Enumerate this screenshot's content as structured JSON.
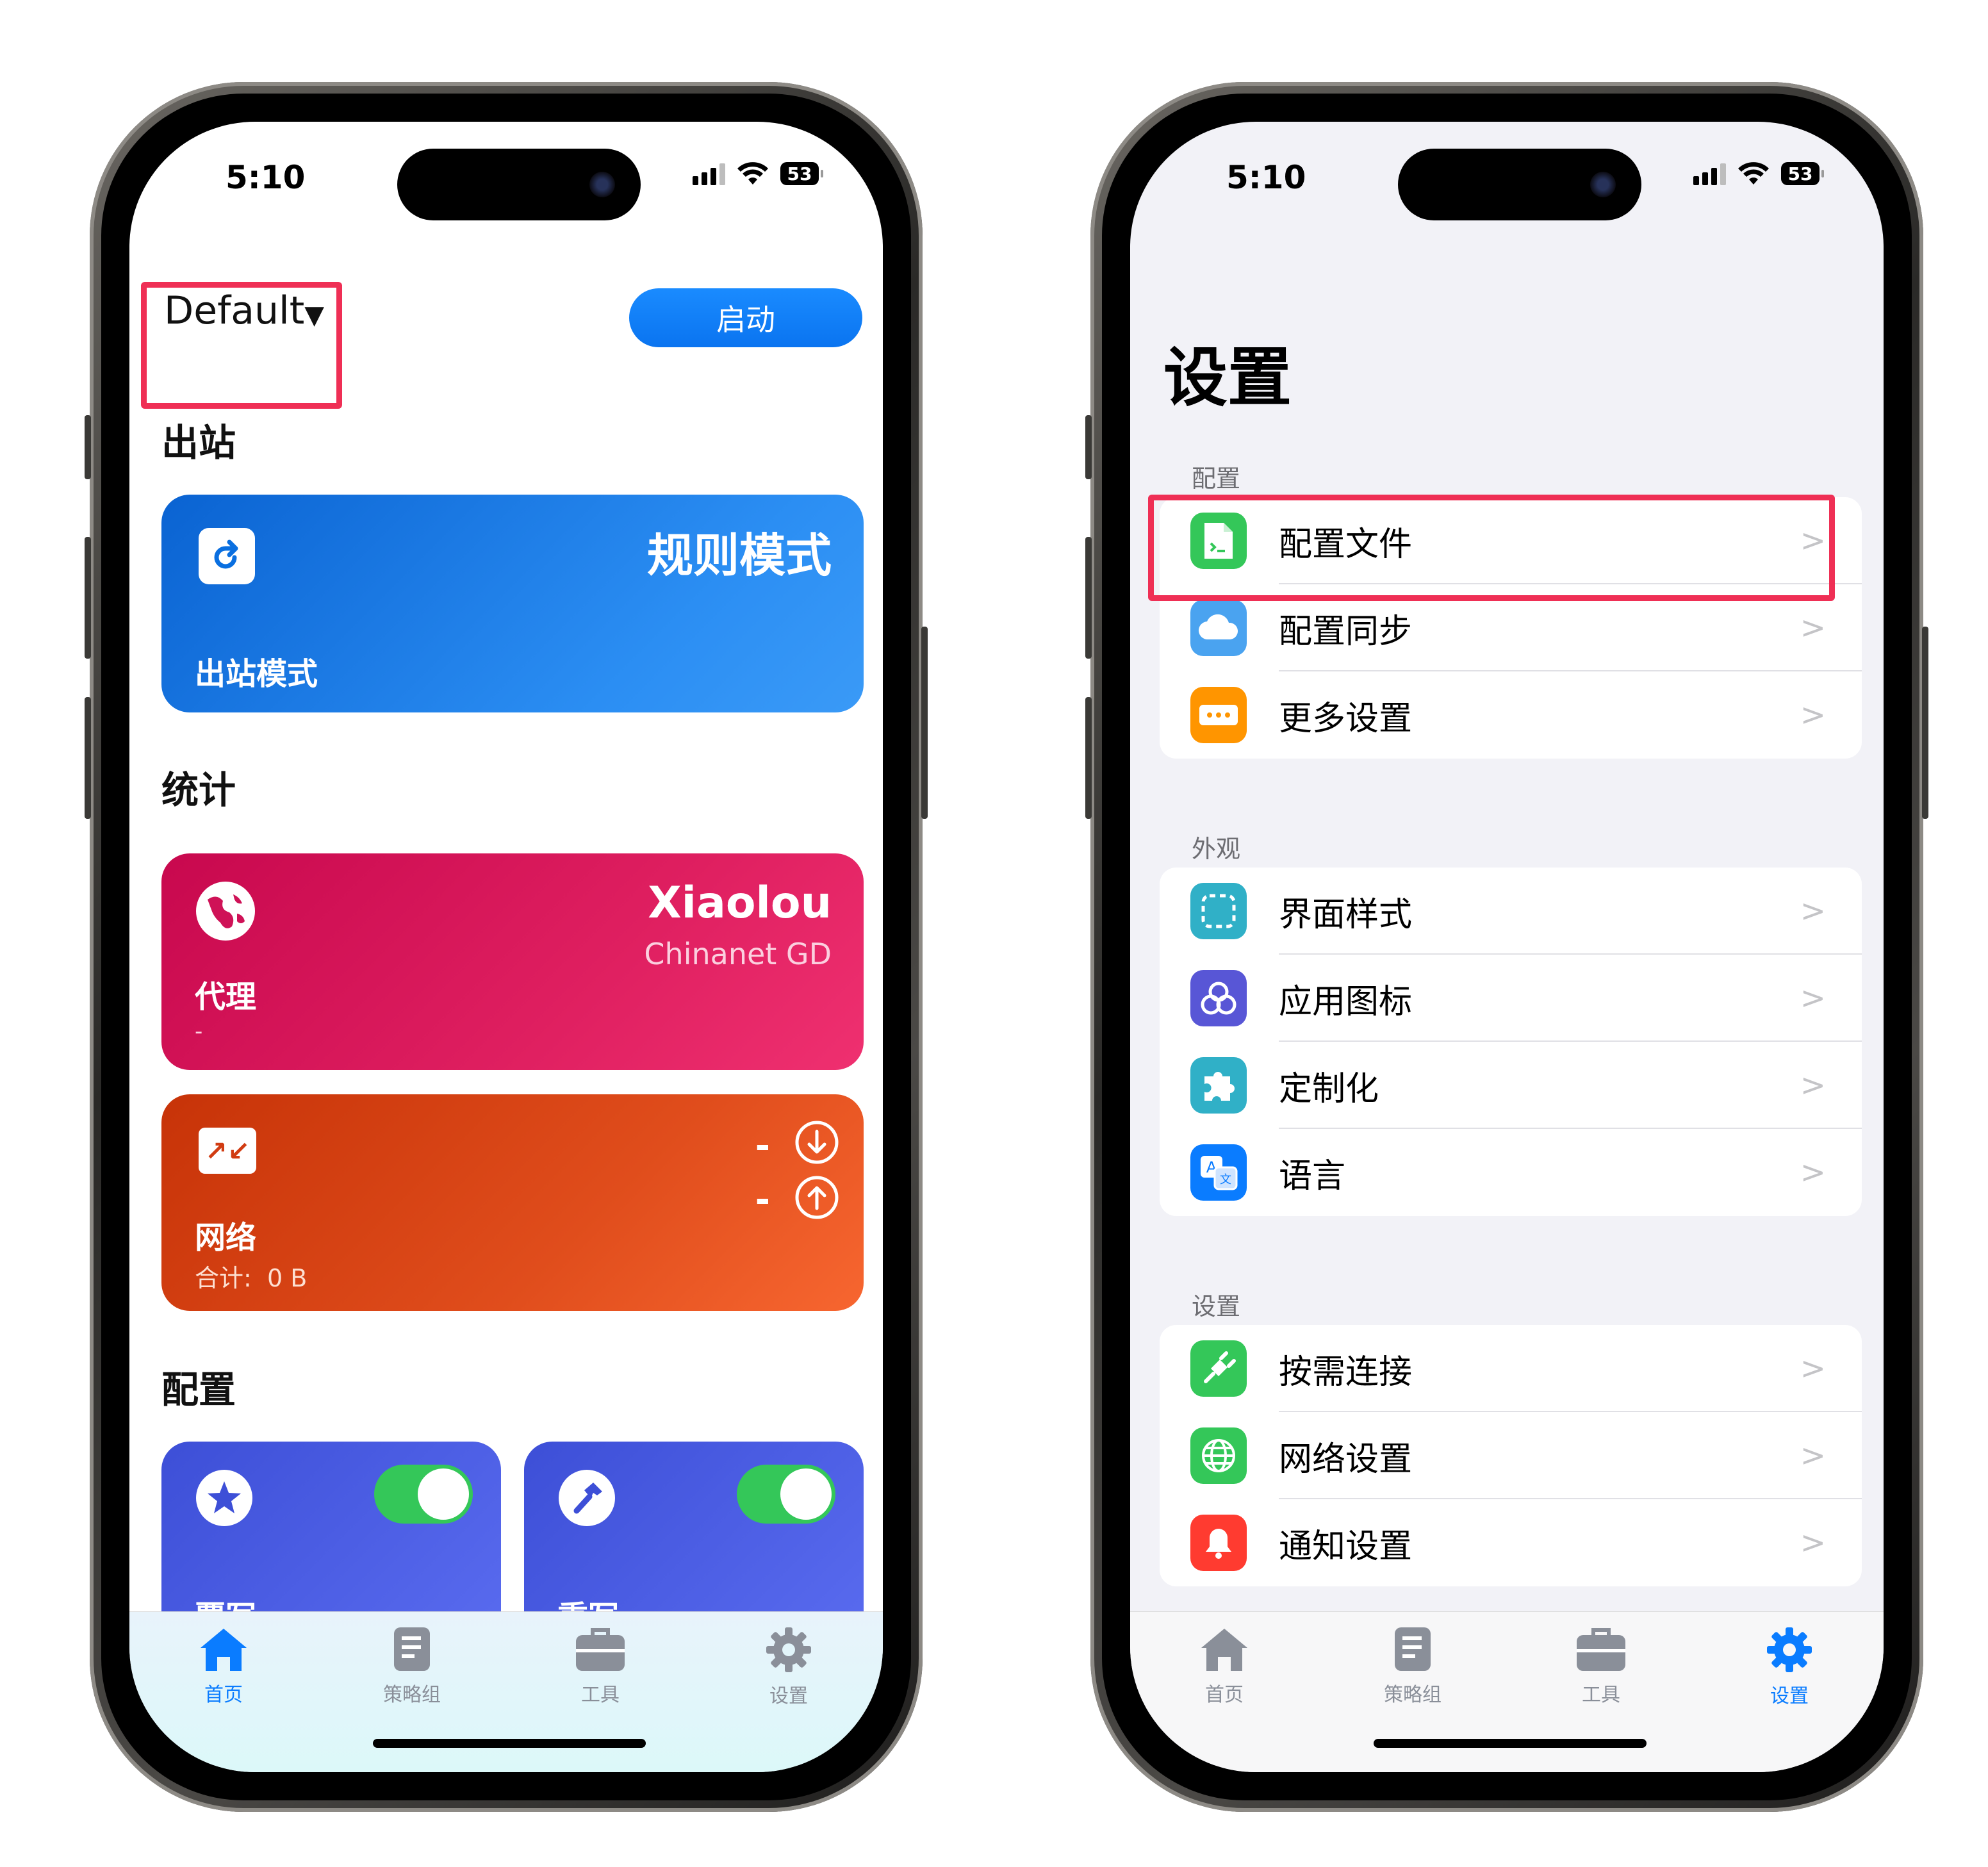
{
  "status_bar": {
    "time": "5:10",
    "battery": "53"
  },
  "left_phone": {
    "profile": "Default",
    "start_button": "启动",
    "outbound": {
      "section": "出站",
      "mode_value": "规则模式",
      "mode_label": "出站模式"
    },
    "stats": {
      "section": "统计",
      "proxy_name": "Xiaolou",
      "proxy_isp": "Chinanet GD",
      "proxy_label": "代理",
      "proxy_sub": "-",
      "download": "-",
      "upload": "-",
      "network_label": "网络",
      "total_label": "合计:",
      "total_value": "0 B"
    },
    "config": {
      "section": "配置",
      "card1_label": "覆写",
      "card1_enabled": true,
      "card2_label": "重写",
      "card2_enabled": true
    },
    "tabs": [
      {
        "label": "首页",
        "icon": "home-icon",
        "active": true
      },
      {
        "label": "策略组",
        "icon": "document-icon",
        "active": false
      },
      {
        "label": "工具",
        "icon": "toolbox-icon",
        "active": false
      },
      {
        "label": "设置",
        "icon": "gear-icon",
        "active": false
      }
    ]
  },
  "right_phone": {
    "title": "设置",
    "groups": [
      {
        "header": "配置",
        "items": [
          {
            "label": "配置文件",
            "icon": "config-file-icon",
            "color": "#34c759"
          },
          {
            "label": "配置同步",
            "icon": "cloud-icon",
            "color": "#4aa3f0"
          },
          {
            "label": "更多设置",
            "icon": "more-icon",
            "color": "#ff9500"
          }
        ]
      },
      {
        "header": "外观",
        "items": [
          {
            "label": "界面样式",
            "icon": "dashed-square-icon",
            "color": "#30b0c7"
          },
          {
            "label": "应用图标",
            "icon": "app-icon-icon",
            "color": "#5856d6"
          },
          {
            "label": "定制化",
            "icon": "puzzle-icon",
            "color": "#30b0c7"
          },
          {
            "label": "语言",
            "icon": "translate-icon",
            "color": "#0a7cff"
          }
        ]
      },
      {
        "header": "设置",
        "items": [
          {
            "label": "按需连接",
            "icon": "plug-icon",
            "color": "#34c759"
          },
          {
            "label": "网络设置",
            "icon": "globe-icon",
            "color": "#34c759"
          },
          {
            "label": "通知设置",
            "icon": "bell-icon",
            "color": "#ff3b30"
          }
        ]
      }
    ],
    "tabs": [
      {
        "label": "首页",
        "icon": "home-icon",
        "active": false
      },
      {
        "label": "策略组",
        "icon": "document-icon",
        "active": false
      },
      {
        "label": "工具",
        "icon": "toolbox-icon",
        "active": false
      },
      {
        "label": "设置",
        "icon": "gear-icon",
        "active": true
      }
    ]
  },
  "colors": {
    "highlight": "#ef2f55",
    "accent": "#0a7cff",
    "toggle_on": "#34c759"
  }
}
